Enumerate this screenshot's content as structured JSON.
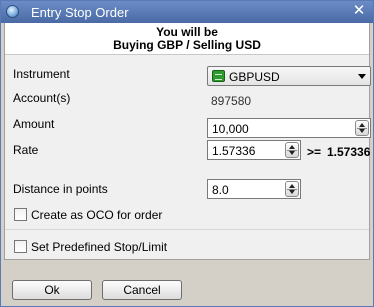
{
  "window": {
    "title": "Entry Stop Order",
    "close_glyph": "✕"
  },
  "header": {
    "line1": "You will be",
    "line2": "Buying GBP / Selling USD"
  },
  "instrument": {
    "label": "Instrument",
    "value": "GBPUSD",
    "icon": "currency-pair-icon"
  },
  "account": {
    "label": "Account(s)",
    "value": "897580"
  },
  "amount": {
    "label": "Amount",
    "value": "10,000"
  },
  "rate": {
    "label": "Rate",
    "value": "1.57336",
    "comparator": ">=",
    "market_rate": "1.57336"
  },
  "distance": {
    "label": "Distance in points",
    "value": "8.0"
  },
  "oco": {
    "label": "Create as OCO for order",
    "checked": false
  },
  "stop_limit": {
    "label": "Set Predefined Stop/Limit",
    "checked": false
  },
  "buttons": {
    "ok": "Ok",
    "cancel": "Cancel"
  }
}
